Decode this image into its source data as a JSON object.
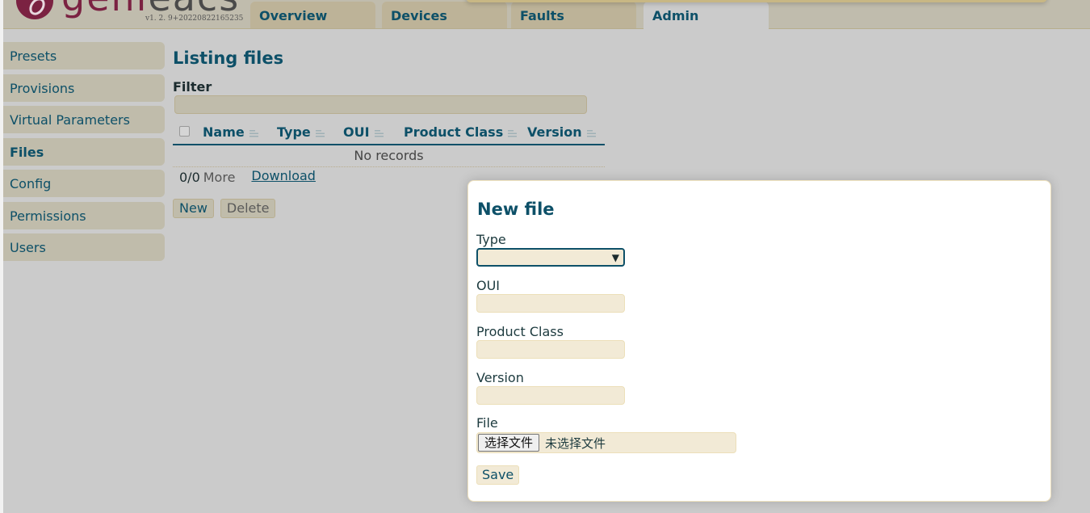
{
  "app": {
    "logo_text_a": "geni",
    "logo_text_b": "eacs",
    "version": "v1. 2. 9+20220822165235",
    "brand_color": "#7b2242",
    "accent_color": "#0d5068"
  },
  "nav": {
    "tabs": [
      {
        "label": "Overview",
        "active": false
      },
      {
        "label": "Devices",
        "active": false
      },
      {
        "label": "Faults",
        "active": false
      },
      {
        "label": "Admin",
        "active": true
      }
    ]
  },
  "sidebar": {
    "items": [
      {
        "label": "Presets",
        "active": false
      },
      {
        "label": "Provisions",
        "active": false
      },
      {
        "label": "Virtual Parameters",
        "active": false
      },
      {
        "label": "Files",
        "active": true
      },
      {
        "label": "Config",
        "active": false
      },
      {
        "label": "Permissions",
        "active": false
      },
      {
        "label": "Users",
        "active": false
      }
    ]
  },
  "main": {
    "title": "Listing files",
    "filter_label": "Filter",
    "filter_value": "",
    "table": {
      "columns": [
        "Name",
        "Type",
        "OUI",
        "Product Class",
        "Version"
      ],
      "rows": [],
      "empty_text": "No records"
    },
    "count": "0/0",
    "more_label": "More",
    "download_label": "Download",
    "new_label": "New",
    "delete_label": "Delete"
  },
  "dialog": {
    "title": "New file",
    "type_label": "Type",
    "type_value": "",
    "oui_label": "OUI",
    "oui_value": "",
    "product_class_label": "Product Class",
    "product_class_value": "",
    "version_label": "Version",
    "version_value": "",
    "file_label": "File",
    "file_button": "选择文件",
    "file_status": "未选择文件",
    "save_label": "Save"
  }
}
